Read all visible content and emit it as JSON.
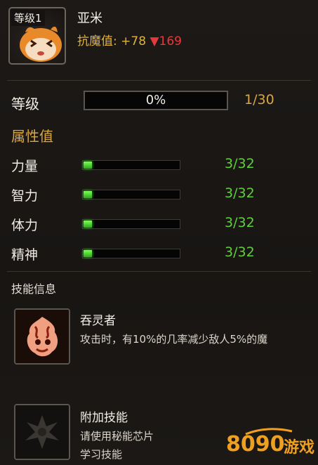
{
  "pet": {
    "level_badge": "等级1",
    "name": "亚米",
    "resist_label": "抗魔值:",
    "resist_plus": "+78",
    "resist_down": "▼169"
  },
  "level": {
    "label": "等级",
    "progress_text": "0%",
    "progress_fraction": 0.0,
    "count": "1/30"
  },
  "attributes": {
    "title": "属性值",
    "items": [
      {
        "name": "力量",
        "value": "3/32",
        "fraction": 0.094
      },
      {
        "name": "智力",
        "value": "3/32",
        "fraction": 0.094
      },
      {
        "name": "体力",
        "value": "3/32",
        "fraction": 0.094
      },
      {
        "name": "精神",
        "value": "3/32",
        "fraction": 0.094
      }
    ]
  },
  "skills": {
    "heading": "技能信息",
    "items": [
      {
        "name": "吞灵者",
        "desc": "攻击时，有10%的几率减少敌人5%的魔"
      },
      {
        "name": "附加技能",
        "desc_line1": "请使用秘能芯片",
        "desc_line2": "学习技能"
      }
    ]
  },
  "watermark": {
    "text": "游戏"
  },
  "colors": {
    "gold": "#d9a640",
    "green": "#5fcf3a",
    "red": "#e23a3a"
  }
}
